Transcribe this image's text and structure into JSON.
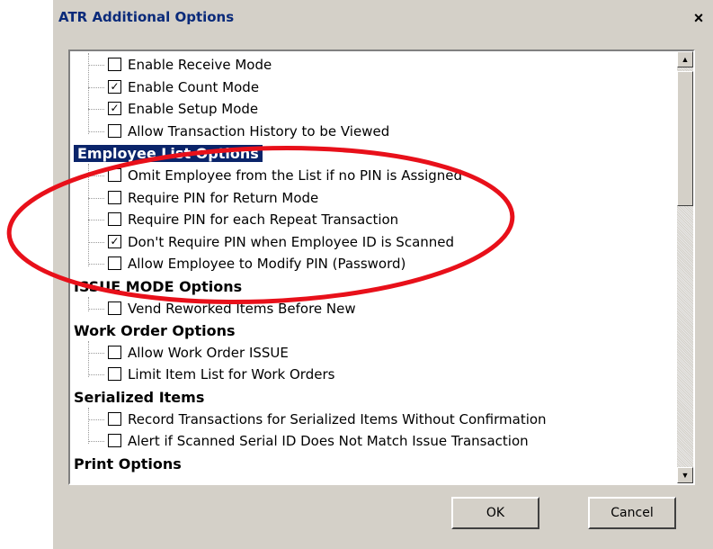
{
  "window": {
    "title": "ATR Additional Options",
    "close_glyph": "×"
  },
  "tree": [
    {
      "type": "item",
      "label": "Enable Receive Mode",
      "checked": false
    },
    {
      "type": "item",
      "label": "Enable Count Mode",
      "checked": true
    },
    {
      "type": "item",
      "label": "Enable Setup Mode",
      "checked": true
    },
    {
      "type": "item",
      "label": "Allow Transaction History to be Viewed",
      "checked": false
    },
    {
      "type": "group",
      "label": "Employee List Options",
      "selected": true
    },
    {
      "type": "item",
      "label": "Omit Employee from the List if no PIN is Assigned",
      "checked": false
    },
    {
      "type": "item",
      "label": "Require PIN for Return Mode",
      "checked": false
    },
    {
      "type": "item",
      "label": "Require PIN for each Repeat Transaction",
      "checked": false
    },
    {
      "type": "item",
      "label": "Don't Require PIN when Employee ID is Scanned",
      "checked": true
    },
    {
      "type": "item",
      "label": "Allow Employee to Modify PIN (Password)",
      "checked": false
    },
    {
      "type": "group",
      "label": "ISSUE MODE Options",
      "selected": false
    },
    {
      "type": "item",
      "label": "Vend Reworked Items Before New",
      "checked": false
    },
    {
      "type": "group",
      "label": "Work Order Options",
      "selected": false
    },
    {
      "type": "item",
      "label": "Allow Work Order ISSUE",
      "checked": false
    },
    {
      "type": "item",
      "label": "Limit Item List for Work Orders",
      "checked": false
    },
    {
      "type": "group",
      "label": "Serialized Items",
      "selected": false
    },
    {
      "type": "item",
      "label": "Record Transactions for Serialized Items Without Confirmation",
      "checked": false
    },
    {
      "type": "item",
      "label": "Alert if Scanned Serial ID Does Not Match Issue Transaction",
      "checked": false
    },
    {
      "type": "group",
      "label": "Print Options",
      "selected": false
    }
  ],
  "buttons": {
    "ok_label": "OK",
    "cancel_label": "Cancel"
  },
  "colors": {
    "selection": "#0a246a",
    "annotation": "#e8101a"
  }
}
